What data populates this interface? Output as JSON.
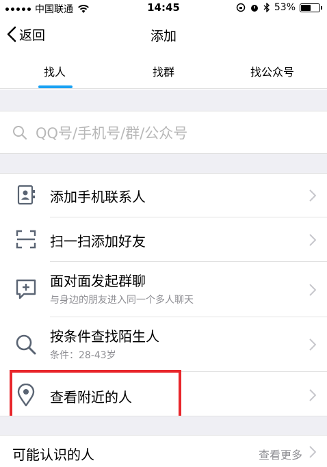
{
  "status_bar": {
    "carrier": "中国联通",
    "time": "14:45",
    "battery": "53%",
    "battery_level": 0.53
  },
  "nav": {
    "back_label": "返回",
    "title": "添加"
  },
  "tabs": [
    {
      "label": "找人",
      "active": true
    },
    {
      "label": "找群",
      "active": false
    },
    {
      "label": "找公众号",
      "active": false
    }
  ],
  "search": {
    "placeholder": "QQ号/手机号/群/公众号"
  },
  "list": [
    {
      "icon": "contact-book-icon",
      "title": "添加手机联系人",
      "subtitle": ""
    },
    {
      "icon": "scan-icon",
      "title": "扫一扫添加好友",
      "subtitle": ""
    },
    {
      "icon": "chat-add-icon",
      "title": "面对面发起群聊",
      "subtitle": "与身边的朋友进入同一个多人聊天"
    },
    {
      "icon": "search-icon",
      "title": "按条件查找陌生人",
      "subtitle": "条件：28-43岁"
    },
    {
      "icon": "location-pin-icon",
      "title": "查看附近的人",
      "subtitle": ""
    }
  ],
  "known": {
    "title": "可能认识的人",
    "more": "查看更多"
  },
  "colors": {
    "accent": "#19a1f3",
    "highlight": "#e8262b",
    "separator": "#efeff4",
    "icon": "#5a6473"
  }
}
